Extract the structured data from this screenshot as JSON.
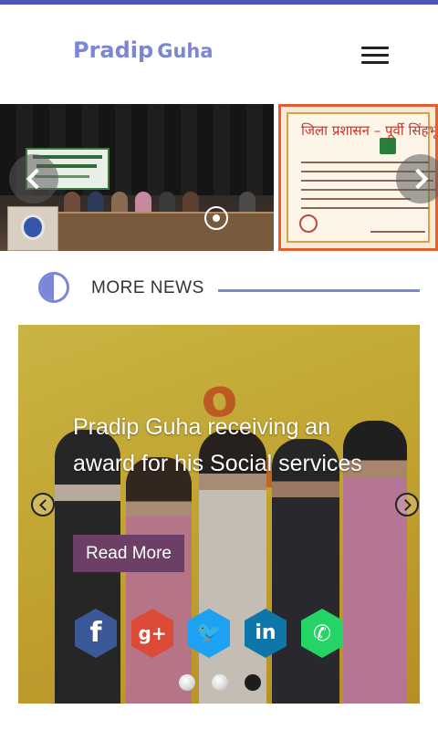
{
  "header": {
    "logo_first": "Pradip",
    "logo_last": "Guha",
    "menu_icon": "hamburger-menu-icon"
  },
  "top_carousel": {
    "slides": [
      {
        "kind": "event-photo"
      },
      {
        "kind": "certificate",
        "title": "जिला प्रशासन – पूर्वी सिंहभूम, ज"
      }
    ],
    "prev_icon": "chevron-left-icon",
    "next_icon": "chevron-right-icon"
  },
  "news_section": {
    "title": "MORE NEWS",
    "icon": "half-circle-icon",
    "accent_color": "#7b86d6"
  },
  "news_card": {
    "headline": "Pradip Guha receiving an award for his Social services",
    "read_more": "Read More",
    "read_more_color": "#6b3f66",
    "prev_icon": "circle-chevron-left-icon",
    "next_icon": "circle-chevron-right-icon",
    "share": [
      {
        "name": "facebook",
        "glyph": "f",
        "color": "#3b5998"
      },
      {
        "name": "google-plus",
        "glyph": "g+",
        "color": "#dc4a38"
      },
      {
        "name": "twitter",
        "glyph": "🐦",
        "color": "#1da1f2"
      },
      {
        "name": "linkedin",
        "glyph": "in",
        "color": "#0e76a8"
      },
      {
        "name": "whatsapp",
        "glyph": "✆",
        "color": "#25d366"
      }
    ],
    "dots": {
      "count": 3,
      "active_index": 2
    }
  }
}
